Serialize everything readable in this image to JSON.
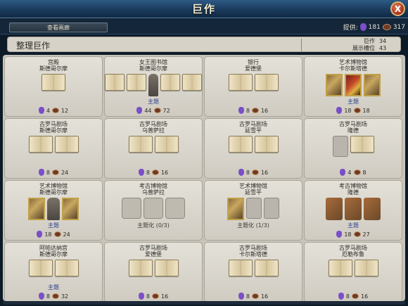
{
  "window": {
    "title": "巨作",
    "close_label": "X"
  },
  "topbar": {
    "view_button": "查看画廊",
    "provide_label": "提供:",
    "tourism": "181",
    "culture": "317"
  },
  "summary": {
    "heading": "整理巨作",
    "works_label": "巨作",
    "works_value": "34",
    "slots_label": "展示槽位",
    "slots_value": "43"
  },
  "cards": [
    {
      "t1": "宫殿",
      "t2": "斯德哥尔摩",
      "slots": [
        "book"
      ],
      "theme": "",
      "tourism": "4",
      "culture": "12"
    },
    {
      "t1": "女王图书馆",
      "t2": "斯德哥尔摩",
      "slots": [
        "book",
        "book",
        "statue",
        "book",
        "book"
      ],
      "theme": "主题",
      "tourism": "44",
      "culture": "72"
    },
    {
      "t1": "银行",
      "t2": "爱德堡",
      "slots": [
        "book",
        "book"
      ],
      "theme": "",
      "tourism": "8",
      "culture": "16"
    },
    {
      "t1": "艺术博物馆",
      "t2": "卡尔斯塔德",
      "slots": [
        "art",
        "art-red",
        "art"
      ],
      "theme": "主题",
      "tourism": "18",
      "culture": "18"
    },
    {
      "t1": "古罗马剧场",
      "t2": "斯德哥尔摩",
      "slots": [
        "book",
        "book"
      ],
      "theme": "",
      "tourism": "8",
      "culture": "24"
    },
    {
      "t1": "古罗马剧场",
      "t2": "乌普萨拉",
      "slots": [
        "book",
        "book"
      ],
      "theme": "",
      "tourism": "8",
      "culture": "16"
    },
    {
      "t1": "古罗马剧场",
      "t2": "延雪平",
      "slots": [
        "book",
        "book"
      ],
      "theme": "",
      "tourism": "8",
      "culture": "16"
    },
    {
      "t1": "古罗马剧场",
      "t2": "隆德",
      "slots": [
        "empty",
        "book"
      ],
      "theme": "",
      "tourism": "4",
      "culture": "8"
    },
    {
      "t1": "艺术博物馆",
      "t2": "斯德哥尔摩",
      "slots": [
        "art",
        "statue",
        "art"
      ],
      "theme": "主题",
      "tourism": "18",
      "culture": "24"
    },
    {
      "t1": "考古博物馆",
      "t2": "乌普萨拉",
      "slots": [
        "emptywide",
        "emptywide",
        "emptywide"
      ],
      "theme": "主题化 (0/3)",
      "tourism": "",
      "culture": ""
    },
    {
      "t1": "艺术博物馆",
      "t2": "延雪平",
      "slots": [
        "art",
        "empty",
        "empty"
      ],
      "theme": "主题化 (1/3)",
      "tourism": "",
      "culture": ""
    },
    {
      "t1": "考古博物馆",
      "t2": "隆德",
      "slots": [
        "relic",
        "relic",
        "relic"
      ],
      "theme": "主题",
      "tourism": "18",
      "culture": "27"
    },
    {
      "t1": "阿帕达纳宫",
      "t2": "斯德哥尔摩",
      "slots": [
        "book",
        "book"
      ],
      "theme": "主题",
      "tourism": "8",
      "culture": "32"
    },
    {
      "t1": "古罗马剧场",
      "t2": "爱德堡",
      "slots": [
        "book",
        "book"
      ],
      "theme": "",
      "tourism": "8",
      "culture": "16"
    },
    {
      "t1": "古罗马剧场",
      "t2": "卡尔斯塔德",
      "slots": [
        "book",
        "book"
      ],
      "theme": "",
      "tourism": "8",
      "culture": "16"
    },
    {
      "t1": "古罗马剧场",
      "t2": "厄勒布鲁",
      "slots": [
        "book",
        "book"
      ],
      "theme": "",
      "tourism": "8",
      "culture": "16"
    }
  ]
}
